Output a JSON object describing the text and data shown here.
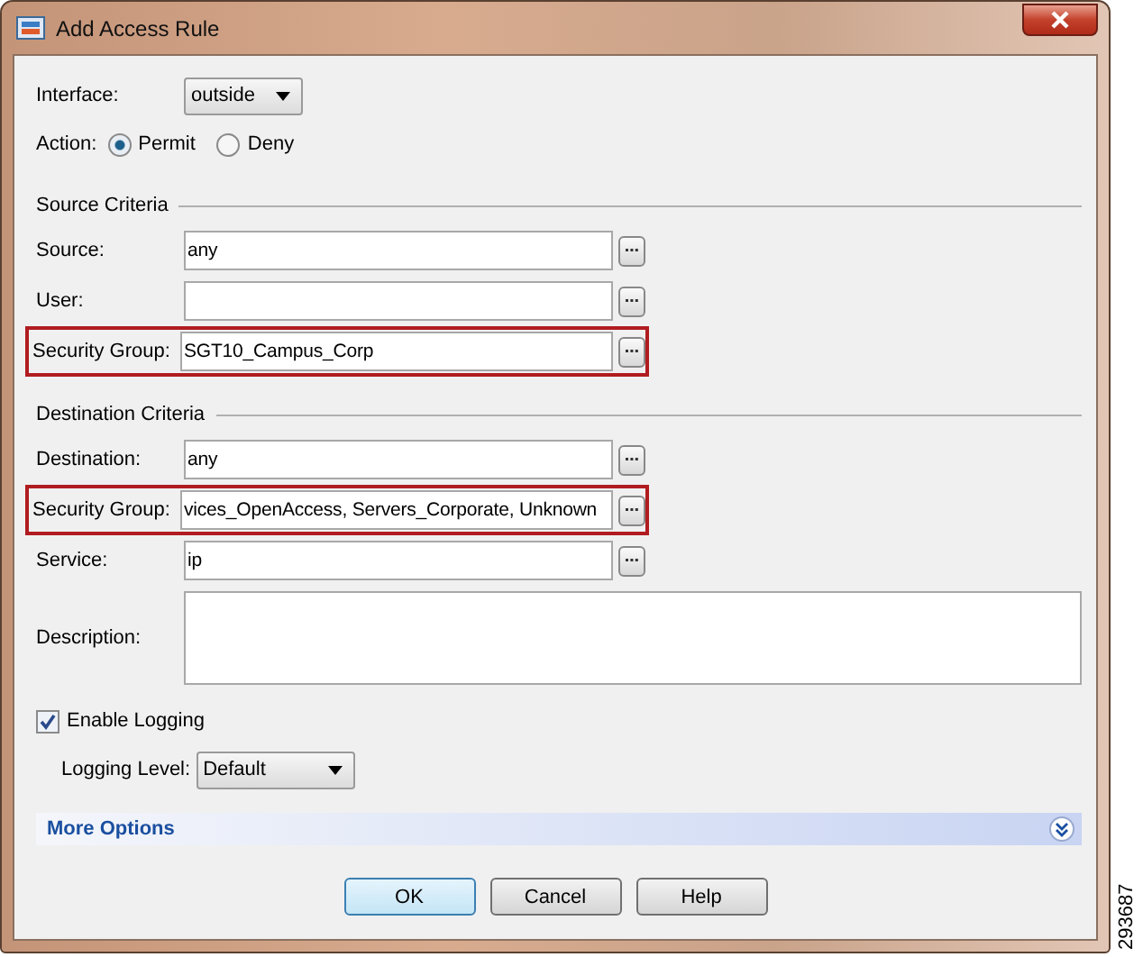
{
  "window": {
    "title": "Add Access Rule"
  },
  "interface": {
    "label": "Interface:",
    "value": "outside"
  },
  "action": {
    "label": "Action:",
    "options": [
      {
        "label": "Permit",
        "selected": true
      },
      {
        "label": "Deny",
        "selected": false
      }
    ]
  },
  "sections": [
    {
      "title": "Source Criteria",
      "fields": [
        {
          "label": "Source:",
          "value": "any",
          "highlighted": false
        },
        {
          "label": "User:",
          "highlighted": false
        },
        {
          "label": "Security Group:",
          "value": "SGT10_Campus_Corp",
          "highlighted": true
        }
      ]
    },
    {
      "title": "Destination Criteria",
      "fields": [
        {
          "label": "Destination:",
          "value": "any",
          "highlighted": false
        },
        {
          "label": "Security Group:",
          "value": "vices_OpenAccess, Servers_Corporate, Unknown",
          "highlighted": true
        },
        {
          "label": "Service:",
          "value": "ip",
          "highlighted": false
        }
      ]
    }
  ],
  "description": {
    "label": "Description:"
  },
  "logging": {
    "label": "Enable Logging",
    "checked": true,
    "level_label": "Logging Level:",
    "level_value": "Default"
  },
  "more_options": {
    "label": "More Options"
  },
  "buttons": [
    {
      "label": "OK",
      "selected": true
    },
    {
      "label": "Cancel",
      "selected": false
    },
    {
      "label": "Help",
      "selected": false
    }
  ],
  "figure_id": "293687"
}
